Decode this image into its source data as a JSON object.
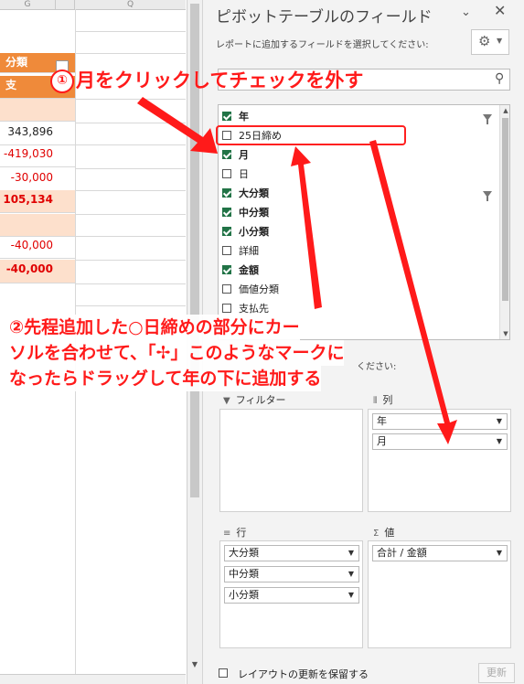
{
  "sheet": {
    "columns": [
      "G",
      "",
      "Q"
    ],
    "header_label_1": "分類",
    "header_label_2": "支",
    "rows": [
      {
        "value": "",
        "style": "peach"
      },
      {
        "value": "343,896",
        "style": "black"
      },
      {
        "value": "-419,030",
        "style": "red"
      },
      {
        "value": "-30,000",
        "style": "red"
      },
      {
        "value": "105,134",
        "style": "peach red bold"
      },
      {
        "value": "",
        "style": "peach"
      },
      {
        "value": "-40,000",
        "style": "red"
      },
      {
        "value": "-40,000",
        "style": "peach red bold"
      }
    ]
  },
  "pane": {
    "title": "ピボットテーブルのフィールド",
    "subtitle": "レポートに追加するフィールドを選択してください:",
    "chevron_icon": "chevron-down-icon",
    "close_icon": "close-icon",
    "gear_icon": "gear-icon",
    "search_placeholder": "",
    "fields": [
      {
        "label": "年",
        "checked": true,
        "filter": true
      },
      {
        "label": "25日締め",
        "checked": false,
        "filter": false
      },
      {
        "label": "月",
        "checked": true,
        "filter": false
      },
      {
        "label": "日",
        "checked": false,
        "filter": false
      },
      {
        "label": "大分類",
        "checked": true,
        "filter": true
      },
      {
        "label": "中分類",
        "checked": true,
        "filter": false
      },
      {
        "label": "小分類",
        "checked": true,
        "filter": false
      },
      {
        "label": "詳細",
        "checked": false,
        "filter": false
      },
      {
        "label": "金額",
        "checked": true,
        "filter": false
      },
      {
        "label": "価値分類",
        "checked": false,
        "filter": false
      },
      {
        "label": "支払先",
        "checked": false,
        "filter": false
      }
    ],
    "drag_hint": "ください:",
    "areas": {
      "filter": {
        "label": "フィルター",
        "items": []
      },
      "columns": {
        "label": "列",
        "items": [
          "年",
          "月"
        ]
      },
      "rows": {
        "label": "行",
        "items": [
          "大分類",
          "中分類",
          "小分類"
        ]
      },
      "values": {
        "label": "値",
        "items": [
          "合計 / 金額"
        ]
      }
    },
    "defer_label": "レイアウトの更新を保留する",
    "update_label": "更新"
  },
  "annotations": {
    "step1_num": "①",
    "step1_text": "月をクリックしてチェックを外す",
    "step2_line1": "②先程追加した○日締めの部分にカー",
    "step2_line2": "ソルを合わせて、「✢」このようなマークに",
    "step2_line3": "なったらドラッグして年の下に追加する",
    "accent_color": "#ff1a1a"
  }
}
